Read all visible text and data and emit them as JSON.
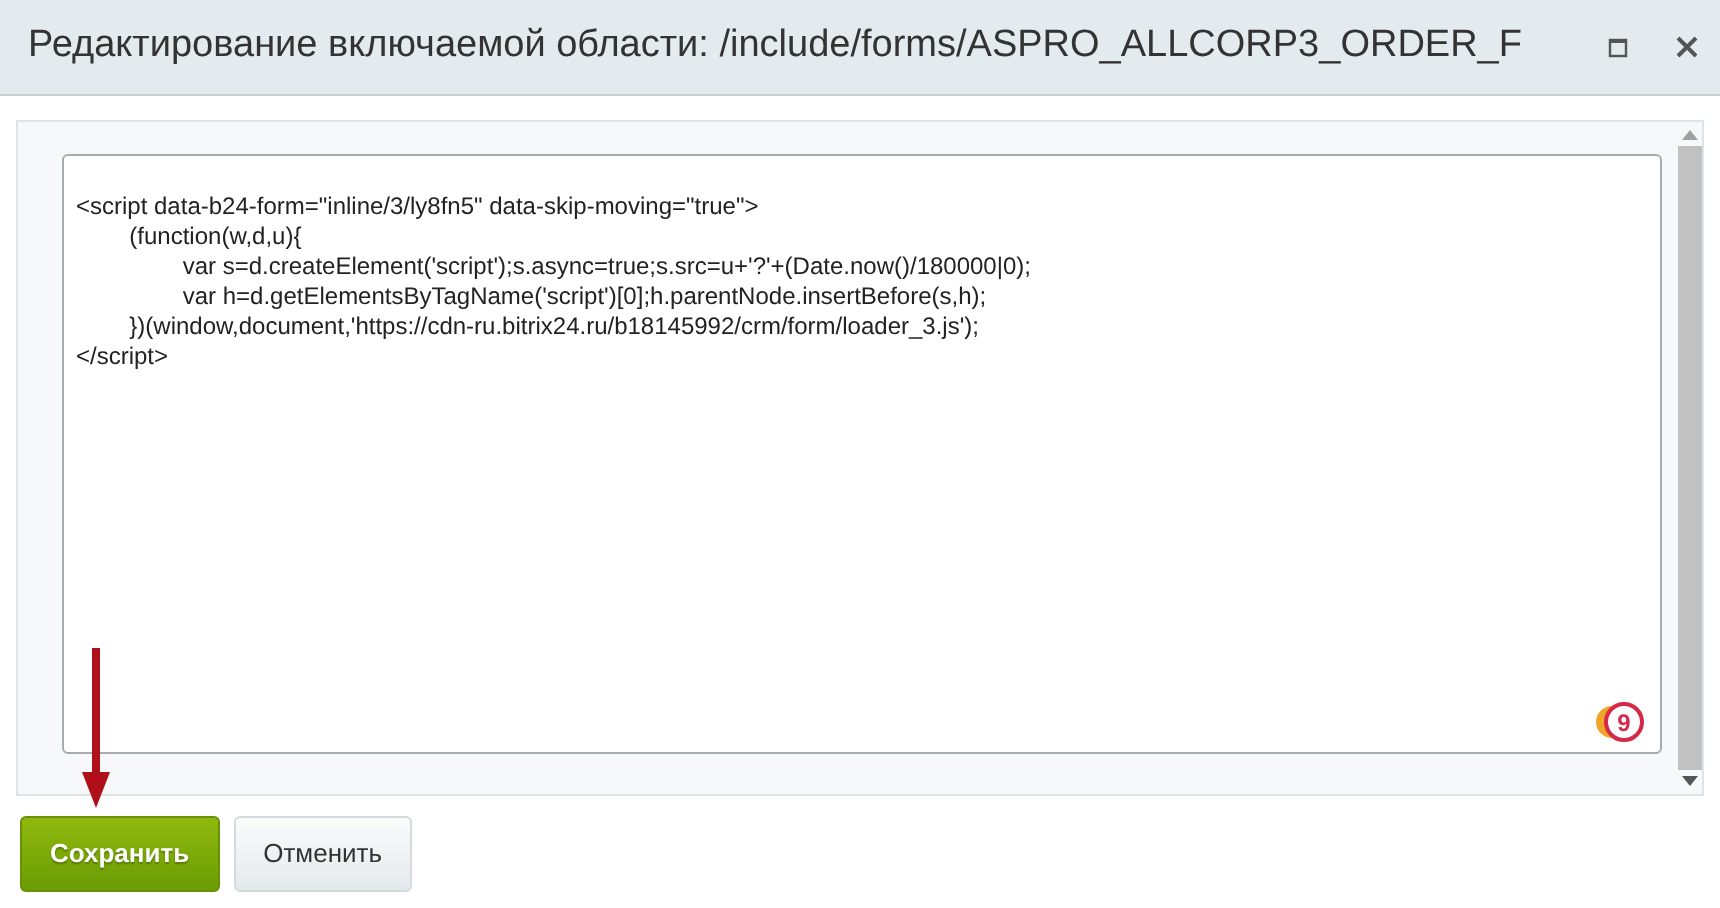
{
  "window": {
    "title": "Редактирование включаемой области: /include/forms/ASPRO_ALLCORP3_ORDER_F"
  },
  "editor": {
    "value": [
      "<script data-b24-form=\"inline/3/ly8fn5\" data-skip-moving=\"true\">",
      "\t(function(w,d,u){",
      "\t\tvar s=d.createElement('script');s.async=true;s.src=u+'?'+(Date.now()/180000|0);",
      "\t\tvar h=d.getElementsByTagName('script')[0];h.parentNode.insertBefore(s,h);",
      "\t})(window,document,'https://cdn-ru.bitrix24.ru/b18145992/crm/form/loader_3.js');",
      "</script>"
    ],
    "badge": "9"
  },
  "buttons": [
    {
      "label": "Сохранить",
      "kind": "primary"
    },
    {
      "label": "Отменить",
      "kind": "secondary"
    }
  ]
}
